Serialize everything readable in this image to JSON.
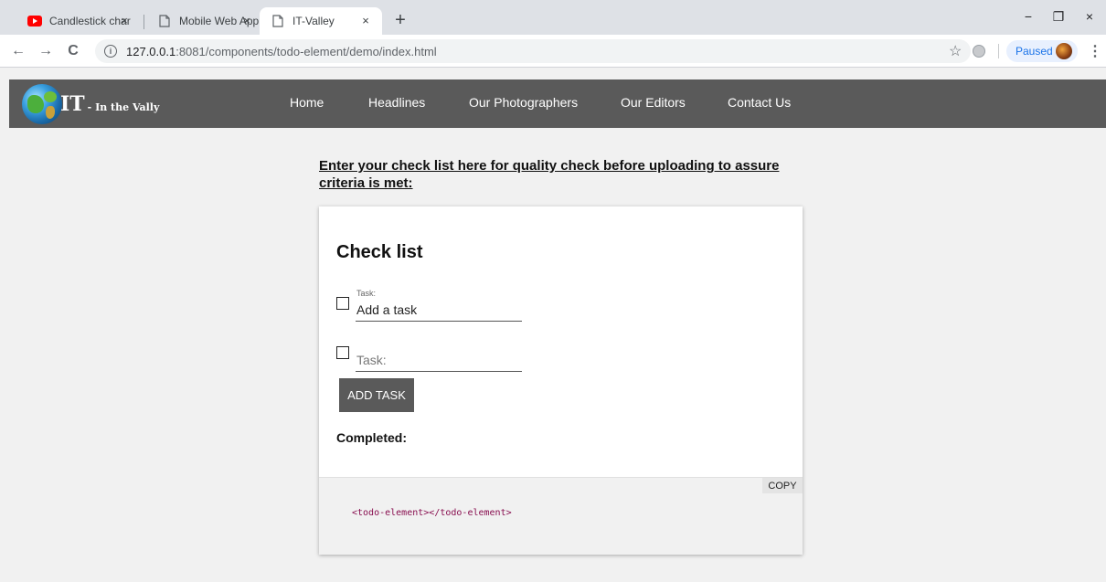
{
  "browser": {
    "tabs": [
      {
        "title": "Candlestick char",
        "favicon": "youtube-icon",
        "close": "×"
      },
      {
        "title": "Mobile Web App",
        "favicon": "page-icon",
        "close": "×"
      },
      {
        "title": "IT-Valley",
        "favicon": "page-icon",
        "close": "×"
      }
    ],
    "new_tab": "+",
    "window_controls": {
      "minimize": "−",
      "restore": "❐",
      "close": "×"
    },
    "nav": {
      "back": "←",
      "forward": "→",
      "reload": "C"
    },
    "url_info_icon": "i",
    "url_host": "127.0.0.1",
    "url_path": ":8081/components/todo-element/demo/index.html",
    "bookmark_star": "☆",
    "profile_label": "Paused",
    "menu_dots": "⋮"
  },
  "site": {
    "brand_big": "IT",
    "brand_small": "- In the Vally",
    "menu": [
      "Home",
      "Headlines",
      "Our Photographers",
      "Our Editors",
      "Contact Us"
    ]
  },
  "content": {
    "intro": "Enter your check list here for quality check before uploading to assure criteria is met:",
    "card_title": "Check list",
    "task1_label": "Task:",
    "task1_value": "Add a task",
    "task2_placeholder": "Task:",
    "add_button": "ADD TASK",
    "completed_label": "Completed:",
    "copy_button": "COPY",
    "code_open": "<todo-element>",
    "code_close": "</todo-element>"
  },
  "colors": {
    "header_bg": "#5a5a5a",
    "page_bg": "#f1f1f1",
    "button_bg": "#5a5a5a",
    "code_tag": "#880e4f",
    "youtube_red": "#ff0000"
  }
}
